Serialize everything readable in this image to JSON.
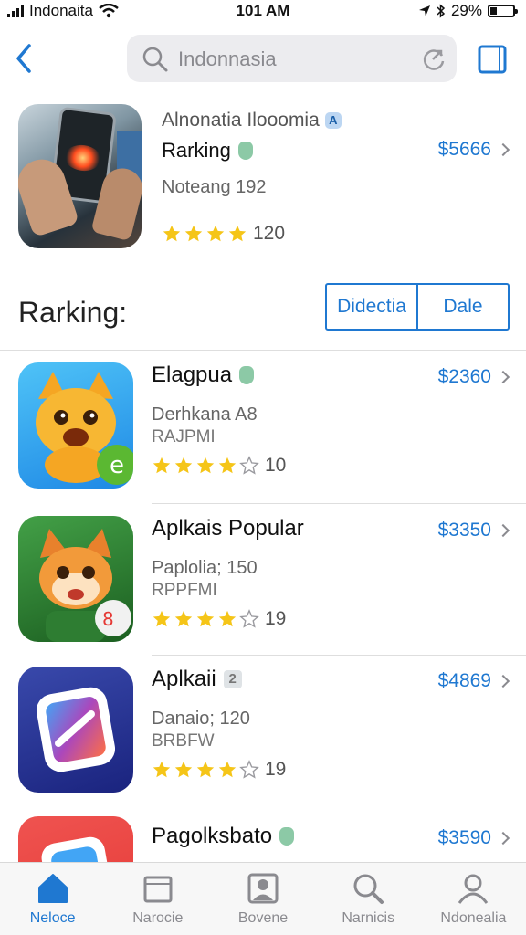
{
  "status": {
    "carrier": "Indonaita",
    "time": "101 AM",
    "battery_text": "29%",
    "battery_level": 0.29
  },
  "search": {
    "placeholder": "Indonnasia"
  },
  "featured": {
    "title": "Alnonatia Ilooomia",
    "title_badge": "A",
    "subtitle": "Rarking",
    "meta": "Noteang 192",
    "price": "$5666",
    "rating": 4,
    "rating_count": "120"
  },
  "section": {
    "title": "Rarking:",
    "segments": [
      "Didectia",
      "Dale"
    ]
  },
  "apps": [
    {
      "name": "Elagpua",
      "line1": "Derhkana A8",
      "line2": "RAJPMI",
      "price": "$2360",
      "rating": 4,
      "count": "10",
      "badge": "green"
    },
    {
      "name": "Aplkais Popular",
      "line1": "Paplolia; 150",
      "line2": "RPPFMI",
      "price": "$3350",
      "rating": 4,
      "count": "19",
      "badge": "none"
    },
    {
      "name": "Aplkaii",
      "line1": "Danaio; 120",
      "line2": "BRBFW",
      "price": "$4869",
      "rating": 4,
      "count": "19",
      "badge": "2"
    },
    {
      "name": "Pagolksbato",
      "line1": "",
      "line2": "",
      "price": "$3590",
      "rating": 0,
      "count": "",
      "badge": "green"
    }
  ],
  "tabs": [
    {
      "label": "Neloce",
      "icon": "home-icon",
      "active": true
    },
    {
      "label": "Narocie",
      "icon": "games-icon",
      "active": false
    },
    {
      "label": "Bovene",
      "icon": "apps-icon",
      "active": false
    },
    {
      "label": "Narnicis",
      "icon": "search-icon",
      "active": false
    },
    {
      "label": "Ndonealia",
      "icon": "profile-icon",
      "active": false
    }
  ],
  "colors": {
    "accent": "#1f78d1",
    "star": "#f5c518"
  }
}
